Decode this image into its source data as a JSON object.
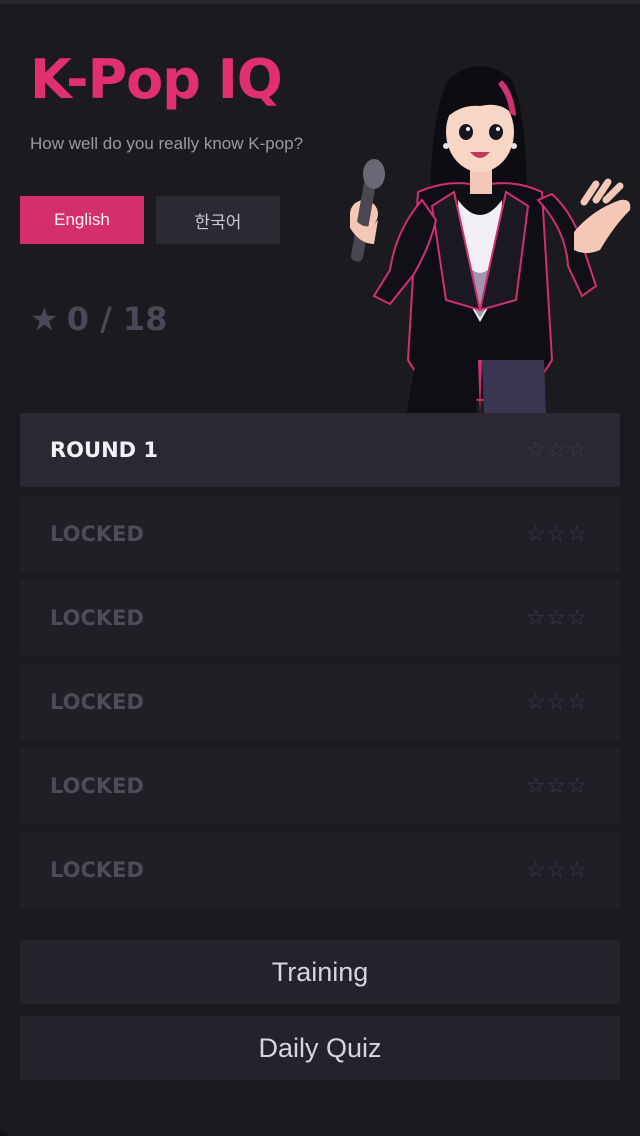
{
  "app": {
    "title": "K-Pop IQ",
    "subtitle": "How well do you really know K-pop?"
  },
  "language": {
    "options": [
      "English",
      "한국어"
    ],
    "selected": "English"
  },
  "score": {
    "icon": "star-icon",
    "text": "0 / 18"
  },
  "rounds": [
    {
      "label": "ROUND 1",
      "stars": "☆☆☆",
      "state": "unlocked"
    },
    {
      "label": "LOCKED",
      "stars": "☆☆☆",
      "state": "locked"
    },
    {
      "label": "LOCKED",
      "stars": "☆☆☆",
      "state": "locked"
    },
    {
      "label": "LOCKED",
      "stars": "☆☆☆",
      "state": "locked"
    },
    {
      "label": "LOCKED",
      "stars": "☆☆☆",
      "state": "locked"
    },
    {
      "label": "LOCKED",
      "stars": "☆☆☆",
      "state": "locked"
    }
  ],
  "buttons": {
    "training": "Training",
    "daily_quiz": "Daily Quiz"
  },
  "colors": {
    "accent": "#d42e6c",
    "title": "#e0306f",
    "background": "#1b1b1f"
  }
}
